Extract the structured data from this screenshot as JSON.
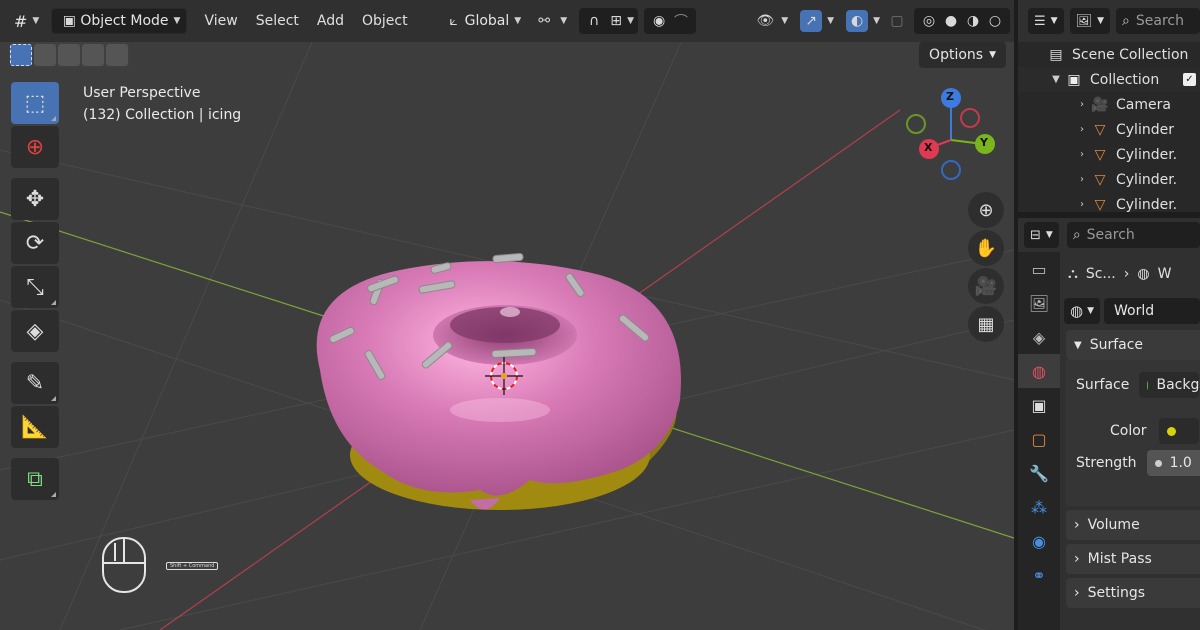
{
  "header": {
    "editor_icon": "#",
    "mode": "Object Mode",
    "menus": [
      "View",
      "Select",
      "Add",
      "Object"
    ],
    "transform_orientation": "Global"
  },
  "viewport": {
    "options_label": "Options",
    "view_name": "User Perspective",
    "collection_info": "(132) Collection | icing",
    "gizmo": {
      "z": "Z",
      "y": "Y",
      "x": "X"
    },
    "hint": "Shift + Command"
  },
  "outliner": {
    "search_placeholder": "Search",
    "scene_collection": "Scene Collection",
    "collection": "Collection",
    "items": [
      {
        "label": "Camera",
        "icon": "camera-icon"
      },
      {
        "label": "Cylinder",
        "icon": "mesh-icon"
      },
      {
        "label": "Cylinder.",
        "icon": "mesh-icon"
      },
      {
        "label": "Cylinder.",
        "icon": "mesh-icon"
      },
      {
        "label": "Cylinder.",
        "icon": "mesh-icon"
      }
    ]
  },
  "properties": {
    "search_placeholder": "Search",
    "breadcrumb_scene": "Sc...",
    "breadcrumb_world": "W",
    "world_name": "World",
    "surface_panel": "Surface",
    "surface_label": "Surface",
    "surface_value": "Backg",
    "color_label": "Color",
    "strength_label": "Strength",
    "strength_value": "1.0",
    "panels": [
      "Volume",
      "Mist Pass",
      "Settings"
    ],
    "colors": {
      "surface_dot": "#4caf50",
      "color_dot": "#d9d20b"
    }
  }
}
